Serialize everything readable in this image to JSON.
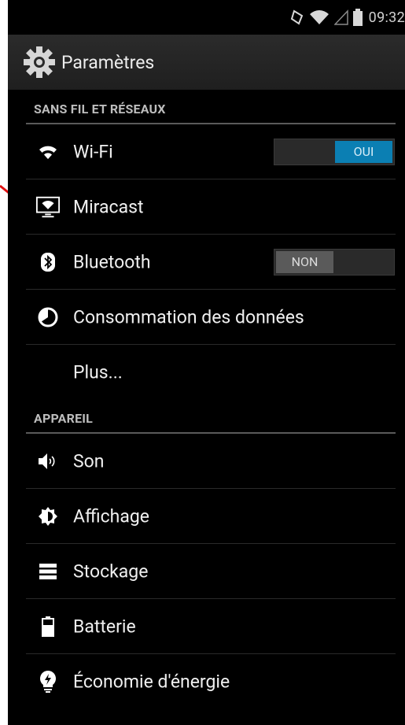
{
  "status_bar": {
    "time": "09:32"
  },
  "action_bar": {
    "title": "Paramètres"
  },
  "sections": [
    {
      "header": "SANS FIL ET RÉSEAUX",
      "items": [
        {
          "label": "Wi-Fi",
          "icon": "wifi-icon",
          "toggle": "OUI"
        },
        {
          "label": "Miracast",
          "icon": "miracast-icon"
        },
        {
          "label": "Bluetooth",
          "icon": "bluetooth-icon",
          "toggle": "NON"
        },
        {
          "label": "Consommation des données",
          "icon": "data-usage-icon"
        },
        {
          "label": "Plus...",
          "icon": ""
        }
      ]
    },
    {
      "header": "APPAREIL",
      "items": [
        {
          "label": "Son",
          "icon": "sound-icon"
        },
        {
          "label": "Affichage",
          "icon": "display-icon"
        },
        {
          "label": "Stockage",
          "icon": "storage-icon"
        },
        {
          "label": "Batterie",
          "icon": "battery-icon"
        },
        {
          "label": "Économie d'énergie",
          "icon": "power-saving-icon"
        }
      ]
    }
  ],
  "colors": {
    "accent": "#0b7fb3",
    "annotation_arrow": "#e01010"
  }
}
